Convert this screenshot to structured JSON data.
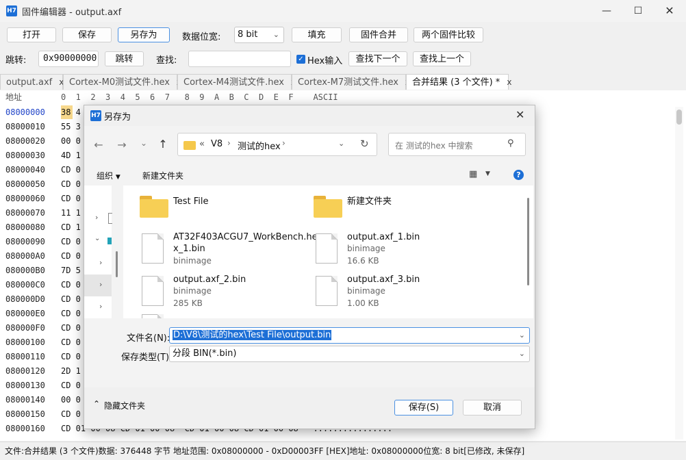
{
  "window": {
    "title": "固件编辑器 - output.axf",
    "logo": "H7"
  },
  "toolbar": {
    "open": "打开",
    "save": "保存",
    "save_as": "另存为",
    "width_label": "数据位宽:",
    "width_value": "8 bit",
    "fill": "填充",
    "merge": "固件合并",
    "compare": "两个固件比较"
  },
  "search": {
    "jump_label": "跳转:",
    "jump_value": "0x90000000",
    "jump_btn": "跳转",
    "find_label": "查找:",
    "find_value": "",
    "hex_input": "Hex输入",
    "find_next": "查找下一个",
    "find_prev": "查找上一个"
  },
  "tabs": [
    {
      "label": "output.axf"
    },
    {
      "label": "Cortex-M0测试文件.hex"
    },
    {
      "label": "Cortex-M4测试文件.hex"
    },
    {
      "label": "Cortex-M7测试文件.hex"
    },
    {
      "label": "合并结果 (3 个文件) *"
    }
  ],
  "hex": {
    "addr_header": "地址",
    "col_header": "0  1  2  3  4  5  6  7   8  9  A  B  C  D  E  F    ASCII",
    "rows": [
      {
        "addr": "08000000",
        "bytes": "38 4"
      },
      {
        "addr": "08000010",
        "bytes": "55 3"
      },
      {
        "addr": "08000020",
        "bytes": "00 0"
      },
      {
        "addr": "08000030",
        "bytes": "4D 1"
      },
      {
        "addr": "08000040",
        "bytes": "CD 0"
      },
      {
        "addr": "08000050",
        "bytes": "CD 0"
      },
      {
        "addr": "08000060",
        "bytes": "CD 0"
      },
      {
        "addr": "08000070",
        "bytes": "11 1"
      },
      {
        "addr": "08000080",
        "bytes": "CD 1"
      },
      {
        "addr": "08000090",
        "bytes": "CD 0"
      },
      {
        "addr": "080000A0",
        "bytes": "CD 0"
      },
      {
        "addr": "080000B0",
        "bytes": "7D 5"
      },
      {
        "addr": "080000C0",
        "bytes": "CD 0"
      },
      {
        "addr": "080000D0",
        "bytes": "CD 0"
      },
      {
        "addr": "080000E0",
        "bytes": "CD 0"
      },
      {
        "addr": "080000F0",
        "bytes": "CD 0"
      },
      {
        "addr": "08000100",
        "bytes": "CD 0"
      },
      {
        "addr": "08000110",
        "bytes": "CD 0"
      },
      {
        "addr": "08000120",
        "bytes": "2D 1"
      },
      {
        "addr": "08000130",
        "bytes": "CD 0"
      },
      {
        "addr": "08000140",
        "bytes": "00 0"
      },
      {
        "addr": "08000150",
        "bytes": "CD 0"
      },
      {
        "addr": "08000160",
        "bytes": "CD 01 00 08 CD 01 00 08  CD 01 00 08 CD 01 00 08   ................"
      }
    ]
  },
  "status": "文件:合并结果 (3 个文件)数据: 376448 字节   地址范围: 0x08000000 - 0xD00003FF  [HEX]地址: 0x08000000位宽: 8 bit[已修改, 未保存]",
  "dialog": {
    "title": "另存为",
    "logo": "H7",
    "path": [
      "V8",
      "测试的hex"
    ],
    "path_prefix": "«",
    "search_placeholder": "在 测试的hex 中搜索",
    "organize": "组织",
    "new_folder": "新建文件夹",
    "help": "?",
    "items": [
      {
        "name": "Test File",
        "type": "",
        "size": ""
      },
      {
        "name": "新建文件夹",
        "type": "",
        "size": ""
      },
      {
        "name": "AT32F403ACGU7_WorkBench.he",
        "name2": "x_1.bin",
        "type": "binimage",
        "size": ""
      },
      {
        "name": "output.axf_1.bin",
        "type": "binimage",
        "size": "16.6 KB"
      },
      {
        "name": "output.axf_2.bin",
        "type": "binimage",
        "size": "285 KB"
      },
      {
        "name": "output.axf_3.bin",
        "type": "binimage",
        "size": "1.00 KB"
      }
    ],
    "filename_label": "文件名(N):",
    "filename_value": "D:\\V8\\测试的hex\\Test File\\output.bin",
    "filetype_label": "保存类型(T):",
    "filetype_value": "分段 BIN(*.bin)",
    "hide_folders": "隐藏文件夹",
    "save_btn": "保存(S)",
    "cancel_btn": "取消"
  }
}
